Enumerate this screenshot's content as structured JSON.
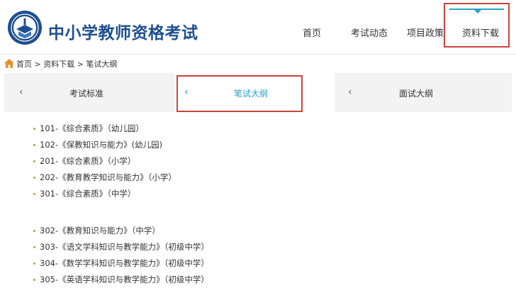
{
  "header": {
    "site_title": "中小学教师资格考试",
    "nav": [
      {
        "label": "首页"
      },
      {
        "label": "考试动态"
      },
      {
        "label": "项目政策"
      },
      {
        "label": "资料下载"
      }
    ],
    "active_nav": "资料下载"
  },
  "breadcrumb": {
    "text": "首页 > 资料下载 > 笔试大纲"
  },
  "tabs": [
    {
      "label": "考试标准"
    },
    {
      "label": "笔试大纲"
    },
    {
      "label": "面试大纲"
    }
  ],
  "active_tab": "笔试大纲",
  "outline_group1": [
    "101-《综合素质》（幼儿园）",
    "102-《保教知识与能力》(幼儿园)",
    "201-《综合素质》（小学）",
    "202-《教育教学知识与能力》（小学）",
    "301-《综合素质》（中学）"
  ],
  "outline_group2": [
    "302-《教育知识与能力》（中学）",
    "303-《语文学科知识与教学能力》（初级中学）",
    "304-《数学学科知识与教学能力》（初级中学）",
    "305-《英语学科知识与教学能力》（初级中学）"
  ],
  "colors": {
    "brand_blue": "#1d4e8f",
    "accent_cyan": "#2aa3c9",
    "highlight_red": "#c8453c",
    "bullet_gold": "#c99a3b"
  },
  "icons": [
    "emblem-logo-icon",
    "home-icon",
    "chevron-left-icon"
  ]
}
